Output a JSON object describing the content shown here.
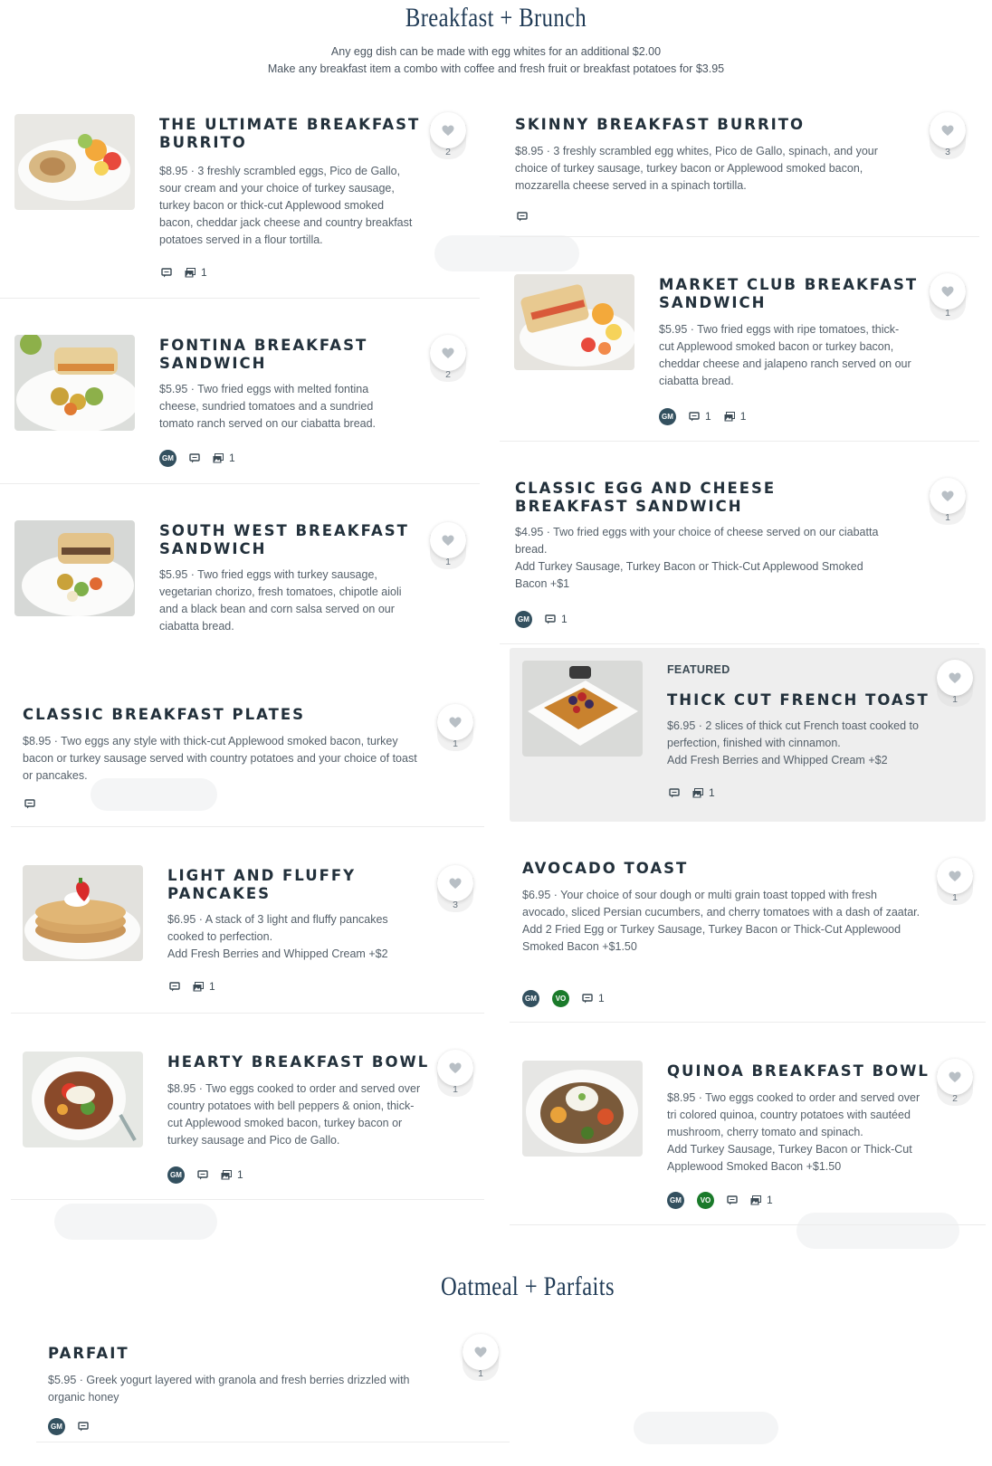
{
  "sections": [
    {
      "title": "Breakfast + Brunch"
    },
    {
      "title": "Oatmeal + Parfaits"
    }
  ],
  "intro": [
    "Any egg dish can be made with egg whites for an additional $2.00",
    "Make any breakfast item a combo with coffee and fresh fruit or breakfast potatoes for $3.95"
  ],
  "featured_label": "FEATURED",
  "badges": {
    "gm": "GM",
    "vo": "VO"
  },
  "colors": {
    "title": "#1f3a55",
    "gm_badge": "#33505f",
    "vo_badge": "#1a7a2a",
    "featured_bg": "#eeeeee"
  },
  "items": {
    "ultimate": {
      "name": "THE ULTIMATE BREAKFAST BURRITO",
      "desc": "$8.95 · 3 freshly scrambled eggs, Pico de Gallo, sour cream and your choice of turkey sausage, turkey bacon or thick-cut Applewood smoked bacon, cheddar jack cheese and country breakfast potatoes served in a flour tortilla.",
      "photos": "1",
      "favs": "2"
    },
    "skinny": {
      "name": "SKINNY BREAKFAST BURRITO",
      "desc": "$8.95 · 3 freshly scrambled egg whites, Pico de Gallo, spinach, and your choice of turkey sausage, turkey bacon or Applewood smoked bacon, mozzarella cheese served in a spinach tortilla.",
      "favs": "3"
    },
    "market": {
      "name": "MARKET CLUB BREAKFAST SANDWICH",
      "desc": "$5.95 · Two fried eggs with ripe tomatoes, thick-cut Applewood smoked bacon or turkey bacon, cheddar cheese and jalapeno ranch served on our ciabatta bread.",
      "comments": "1",
      "photos": "1",
      "favs": "1"
    },
    "fontina": {
      "name": "FONTINA BREAKFAST SANDWICH",
      "desc": "$5.95 · Two fried eggs with melted fontina cheese, sundried tomatoes and a sundried tomato ranch served on our ciabatta bread.",
      "photos": "1",
      "favs": "2"
    },
    "classicegg": {
      "name": "CLASSIC EGG AND CHEESE BREAKFAST SANDWICH",
      "desc": "$4.95 · Two fried eggs with your choice of cheese served on our ciabatta bread.",
      "desc2": "Add Turkey Sausage, Turkey Bacon or Thick-Cut Applewood Smoked Bacon +$1",
      "comments": "1",
      "favs": "1"
    },
    "southwest": {
      "name": "SOUTH WEST BREAKFAST SANDWICH",
      "desc": "$5.95 · Two fried eggs with turkey sausage, vegetarian chorizo, fresh tomatoes, chipotle aioli and a black bean and corn salsa served on our ciabatta bread.",
      "favs": "1"
    },
    "frenchtoast": {
      "name": "THICK CUT FRENCH TOAST",
      "desc": "$6.95 · 2 slices of thick cut French toast cooked to perfection, finished with cinnamon.",
      "desc2": "Add Fresh Berries and Whipped Cream +$2",
      "photos": "1",
      "favs": "1"
    },
    "plates": {
      "name": "CLASSIC BREAKFAST PLATES",
      "desc": "$8.95 · Two eggs any style with thick-cut Applewood smoked bacon, turkey bacon or turkey sausage served with country potatoes and your choice of toast or pancakes.",
      "favs": "1"
    },
    "pancakes": {
      "name": "LIGHT AND FLUFFY PANCAKES",
      "desc": "$6.95 · A stack of 3 light and fluffy pancakes cooked to perfection.",
      "desc2": "Add Fresh Berries and Whipped Cream +$2",
      "photos": "1",
      "favs": "3"
    },
    "avocado": {
      "name": "AVOCADO TOAST",
      "desc": "$6.95 · Your choice of sour dough or multi grain toast topped with fresh avocado, sliced Persian cucumbers, and cherry tomatoes with a dash of zaatar.",
      "desc2": "Add 2 Fried Egg or Turkey Sausage, Turkey Bacon or Thick-Cut Applewood Smoked Bacon +$1.50",
      "comments": "1",
      "favs": "1"
    },
    "hearty": {
      "name": "HEARTY BREAKFAST BOWL",
      "desc": "$8.95 · Two eggs cooked to order and served over country potatoes with bell peppers & onion, thick-cut Applewood smoked bacon, turkey bacon or turkey sausage and Pico de Gallo.",
      "photos": "1",
      "favs": "1"
    },
    "quinoa": {
      "name": "QUINOA BREAKFAST BOWL",
      "desc": "$8.95 · Two eggs cooked to order and served over tri colored quinoa, country potatoes with sautéed mushroom, cherry tomato and spinach.",
      "desc2": "Add Turkey Sausage, Turkey Bacon or Thick-Cut Applewood Smoked Bacon +$1.50",
      "photos": "1",
      "favs": "2"
    },
    "parfait": {
      "name": "PARFAIT",
      "desc": "$5.95 · Greek yogurt layered with granola and fresh berries drizzled with organic honey",
      "favs": "1"
    }
  }
}
